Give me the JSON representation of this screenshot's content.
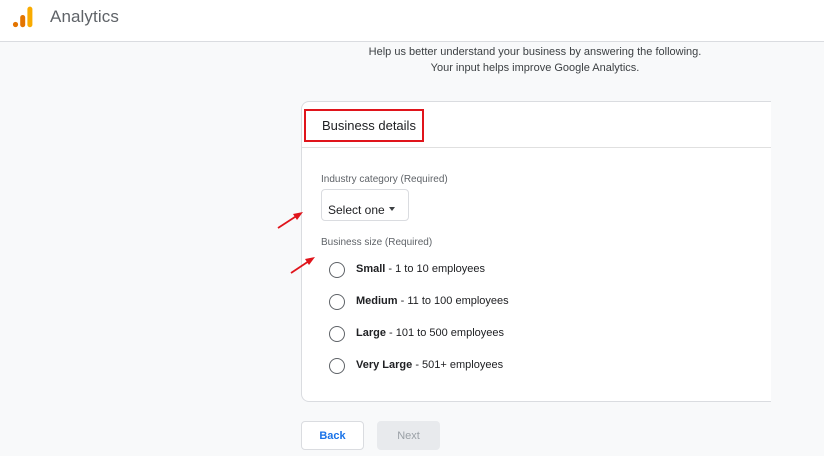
{
  "header": {
    "app_title": "Analytics",
    "logo_icon": "analytics-bars-icon"
  },
  "intro": {
    "line1": "Help us better understand your business by answering the following.",
    "line2": "Your input helps improve Google Analytics."
  },
  "card": {
    "title": "Business details",
    "industry": {
      "label": "Industry category (Required)",
      "selected": "Select one"
    },
    "size": {
      "label": "Business size (Required)",
      "options": [
        {
          "name": "Small",
          "detail": " - 1 to 10 employees",
          "checked": false
        },
        {
          "name": "Medium",
          "detail": " - 11 to 100 employees",
          "checked": false
        },
        {
          "name": "Large",
          "detail": " - 101 to 500 employees",
          "checked": false
        },
        {
          "name": "Very Large",
          "detail": " - 501+ employees",
          "checked": false
        }
      ]
    }
  },
  "buttons": {
    "back": "Back",
    "next": "Next"
  },
  "colors": {
    "accent": "#1a73e8",
    "annotation_red": "#e0141b",
    "logo_orange": "#f9ab00",
    "logo_dark_orange": "#e37400"
  }
}
